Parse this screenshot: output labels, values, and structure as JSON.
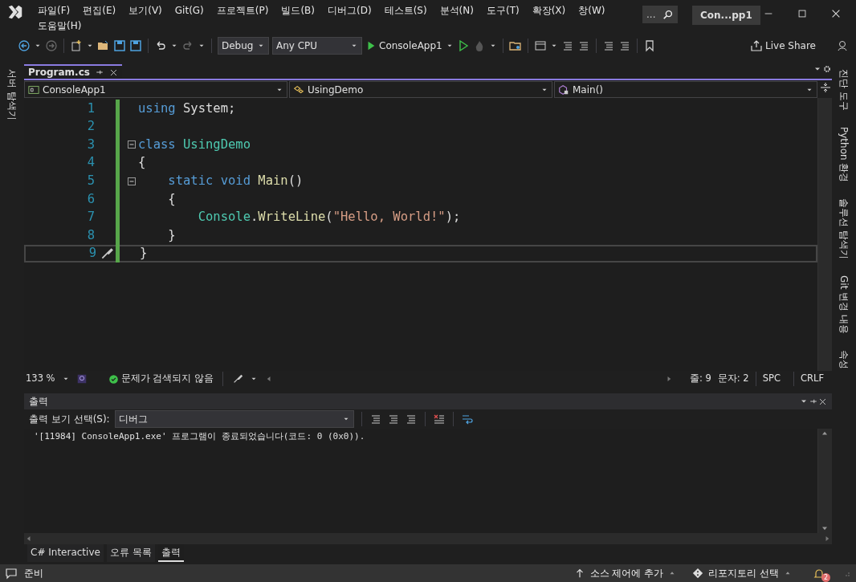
{
  "title_bar": {
    "menu": [
      "파일(F)",
      "편집(E)",
      "보기(V)",
      "Git(G)",
      "프로젝트(P)",
      "빌드(B)",
      "디버그(D)",
      "테스트(S)",
      "분석(N)",
      "도구(T)",
      "확장(X)",
      "창(W)",
      "도움말(H)"
    ],
    "search": "...",
    "solution": "Con...pp1"
  },
  "toolbar": {
    "configuration": "Debug",
    "platform": "Any CPU",
    "start": "ConsoleApp1",
    "live_share": "Live Share"
  },
  "left_sidebar": [
    "서버 탐색기"
  ],
  "right_sidebar": [
    "진단 도구",
    "Python 환경",
    "솔루션 탐색기",
    "Git 변경 내용",
    "속성"
  ],
  "document_tabs": [
    {
      "label": "Program.cs",
      "selected": true
    }
  ],
  "navigation": [
    "ConsoleApp1",
    "UsingDemo",
    "Main()"
  ],
  "code": {
    "lines": [
      {
        "number": "1",
        "tokens": [
          {
            "kind": "keyword",
            "text": "using"
          },
          {
            "kind": "plain",
            "text": " System;"
          }
        ]
      },
      {
        "number": "2"
      },
      {
        "number": "3",
        "expanded": true,
        "tokens": [
          {
            "kind": "keyword",
            "text": "class"
          },
          {
            "kind": "type",
            "text": " UsingDemo"
          }
        ]
      },
      {
        "number": "4",
        "tokens": [
          {
            "kind": "plain",
            "text": "{"
          }
        ]
      },
      {
        "number": "5",
        "expanded": true,
        "tokens": [
          {
            "kind": "keyword",
            "text": "    static void"
          },
          {
            "kind": "method",
            "text": " Main"
          },
          {
            "kind": "plain",
            "text": "()"
          }
        ]
      },
      {
        "number": "6",
        "tokens": [
          {
            "kind": "plain",
            "text": "    {"
          }
        ]
      },
      {
        "number": "7",
        "tokens": [
          {
            "kind": "type",
            "text": "        Console"
          },
          {
            "kind": "plain",
            "text": "."
          },
          {
            "kind": "method",
            "text": "WriteLine"
          },
          {
            "kind": "plain",
            "text": "("
          },
          {
            "kind": "string",
            "text": "\"Hello, World!\""
          },
          {
            "kind": "plain",
            "text": ");"
          }
        ]
      },
      {
        "number": "8",
        "tokens": [
          {
            "kind": "plain",
            "text": "    }"
          }
        ]
      },
      {
        "number": "9",
        "current": true,
        "tokens": [
          {
            "kind": "plain",
            "text": "}"
          }
        ]
      }
    ]
  },
  "editor_status": {
    "zoom": "133 %",
    "issues": "문제가 검색되지 않음",
    "line": "줄: 9",
    "column": "문자: 2",
    "whitespace": "SPC",
    "line_ending": "CRLF"
  },
  "output": {
    "title": "출력",
    "source_label": "출력 보기 선택(S):",
    "source": "디버그",
    "lines": [
      "'[11984] ConsoleApp1.exe' 프로그램이 종료되었습니다(코드: 0 (0x0))."
    ]
  },
  "bottom_tabs": [
    {
      "label": "C# Interactive",
      "selected": false
    },
    {
      "label": "오류 목록",
      "selected": false
    },
    {
      "label": "출력",
      "selected": true
    }
  ],
  "status_bar": {
    "message": "준비",
    "source_control": "소스 제어에 추가",
    "repository": "리포지토리 선택",
    "notifications": "2"
  }
}
